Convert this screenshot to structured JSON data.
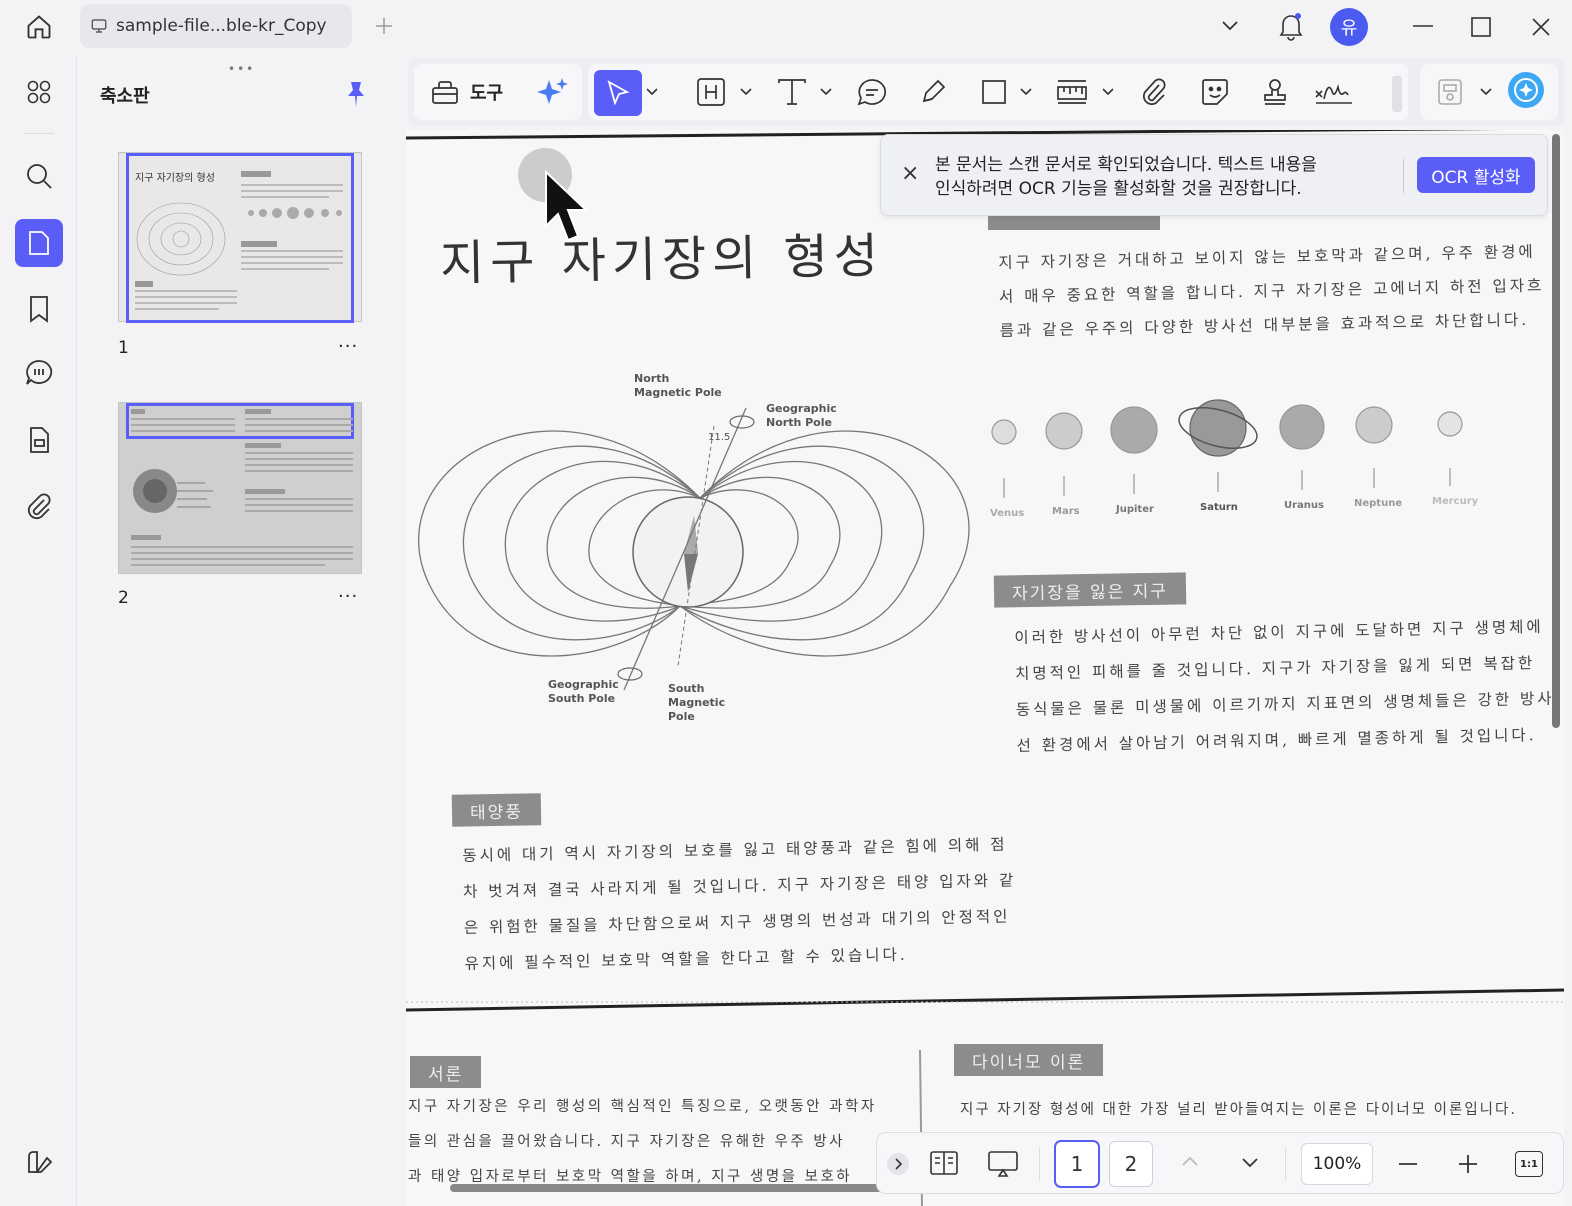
{
  "titlebar": {
    "tab_title": "sample-file...ble-kr_Copy",
    "avatar_initial": "유"
  },
  "thumbnail_panel": {
    "title": "축소판",
    "pages": [
      {
        "number": "1",
        "more": "···"
      },
      {
        "number": "2",
        "more": "···"
      }
    ]
  },
  "toolbar": {
    "tools_label": "도구"
  },
  "ocr_banner": {
    "line1": "본 문서는 스캔 문서로 확인되었습니다. 텍스트 내용을",
    "line2": "인식하려면 OCR 기능을 활성화할 것을 권장합니다.",
    "button": "OCR 활성화",
    "close": "×"
  },
  "document": {
    "title": "지구 자기장의 형성",
    "intro": [
      "지구 자기장은 거대하고 보이지 않는 보호막과 같으며, 우주 환경에",
      "서 매우 중요한 역할을 합니다. 지구 자기장은 고에너지 하전 입자흐",
      "름과 같은 우주의 다양한 방사선 대부분을 효과적으로 차단합니다."
    ],
    "diagram_labels": {
      "north_magnetic": "North\nMagnetic Pole",
      "geo_north": "Geographic\nNorth Pole",
      "angle": "11.5",
      "geo_south": "Geographic\nSouth Pole",
      "south_magnetic": "South\nMagnetic\nPole"
    },
    "planets": [
      "Venus",
      "Mars",
      "Jupiter",
      "Saturn",
      "Uranus",
      "Neptune",
      "Mercury"
    ],
    "section_lost": {
      "heading": "자기장을 잃은 지구",
      "lines": [
        "이러한 방사선이 아무런 차단 없이 지구에 도달하면 지구 생명체에",
        "치명적인 피해를 줄 것입니다. 지구가 자기장을 잃게 되면 복잡한",
        "동식물은 물론 미생물에 이르기까지 지표면의 생명체들은 강한 방사",
        "선 환경에서 살아남기 어려워지며, 빠르게 멸종하게 될 것입니다."
      ]
    },
    "section_solar": {
      "heading": "태양풍",
      "lines": [
        "동시에 대기 역시 자기장의 보호를 잃고 태양풍과 같은 힘에 의해 점",
        "차 벗겨져 결국 사라지게 될 것입니다. 지구 자기장은 태양 입자와 같",
        "은 위험한 물질을 차단함으로써 지구 생명의 번성과 대기의 안정적인",
        "유지에 필수적인 보호막 역할을 한다고 할 수 있습니다."
      ]
    },
    "page2": {
      "intro_heading": "서론",
      "intro_lines": [
        "지구 자기장은 우리 행성의 핵심적인 특징으로, 오랫동안 과학자",
        "들의 관심을 끌어왔습니다. 지구 자기장은 유해한 우주 방사",
        "과 태양 입자로부터 보호막 역할을 하며, 지구 생명을 보호하"
      ],
      "dynamo_heading": "다이너모 이론",
      "dynamo_line": "지구 자기장 형성에 대한 가장 널리 받아들여지는 이론은 다이너모 이론입니다."
    }
  },
  "bottombar": {
    "page1": "1",
    "page2": "2",
    "zoom": "100%",
    "fit": "1:1"
  },
  "colors": {
    "accent": "#5b5ef6",
    "avatar": "#4b5bf0"
  }
}
